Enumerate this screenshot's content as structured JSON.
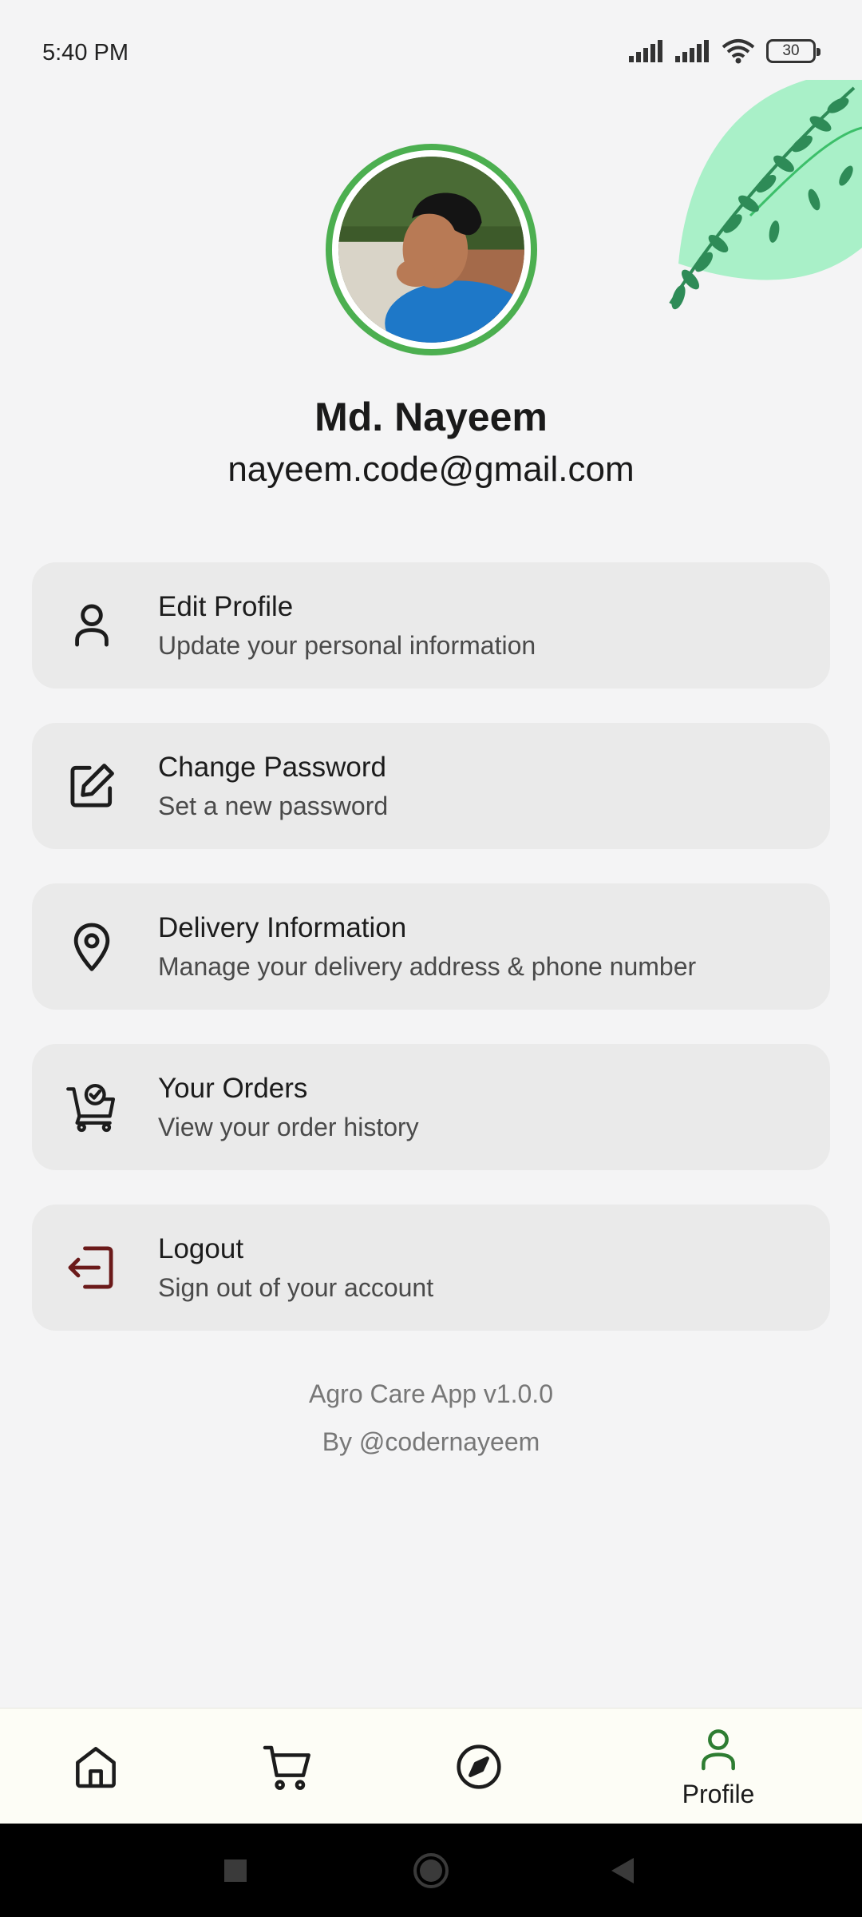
{
  "status_bar": {
    "time": "5:40 PM",
    "battery_level": "30",
    "icons": [
      "signal-icon",
      "signal-icon",
      "wifi-icon",
      "battery-icon"
    ]
  },
  "profile": {
    "name": "Md. Nayeem",
    "email": "nayeem.code@gmail.com",
    "accent_color": "#4caf50"
  },
  "menu": {
    "items": [
      {
        "title": "Edit Profile",
        "subtitle": "Update your personal information",
        "icon": "person-icon"
      },
      {
        "title": "Change Password",
        "subtitle": "Set a new password",
        "icon": "edit-icon"
      },
      {
        "title": "Delivery Information",
        "subtitle": "Manage your delivery address & phone number",
        "icon": "location-pin-icon"
      },
      {
        "title": "Your Orders",
        "subtitle": "View your order history",
        "icon": "cart-check-icon"
      },
      {
        "title": "Logout",
        "subtitle": "Sign out of your account",
        "icon": "logout-icon",
        "icon_color": "#6b1a1a"
      }
    ]
  },
  "footer": {
    "version": "Agro Care App v1.0.0",
    "author": "By @codernayeem"
  },
  "bottom_nav": {
    "items": [
      {
        "icon": "home-icon"
      },
      {
        "icon": "cart-icon"
      },
      {
        "icon": "compass-icon"
      },
      {
        "icon": "profile-icon",
        "label": "Profile",
        "active": true
      }
    ],
    "active_color": "#2e7d32"
  },
  "system_nav": {
    "buttons": [
      "recents-square-icon",
      "home-circle-icon",
      "back-triangle-icon"
    ]
  }
}
